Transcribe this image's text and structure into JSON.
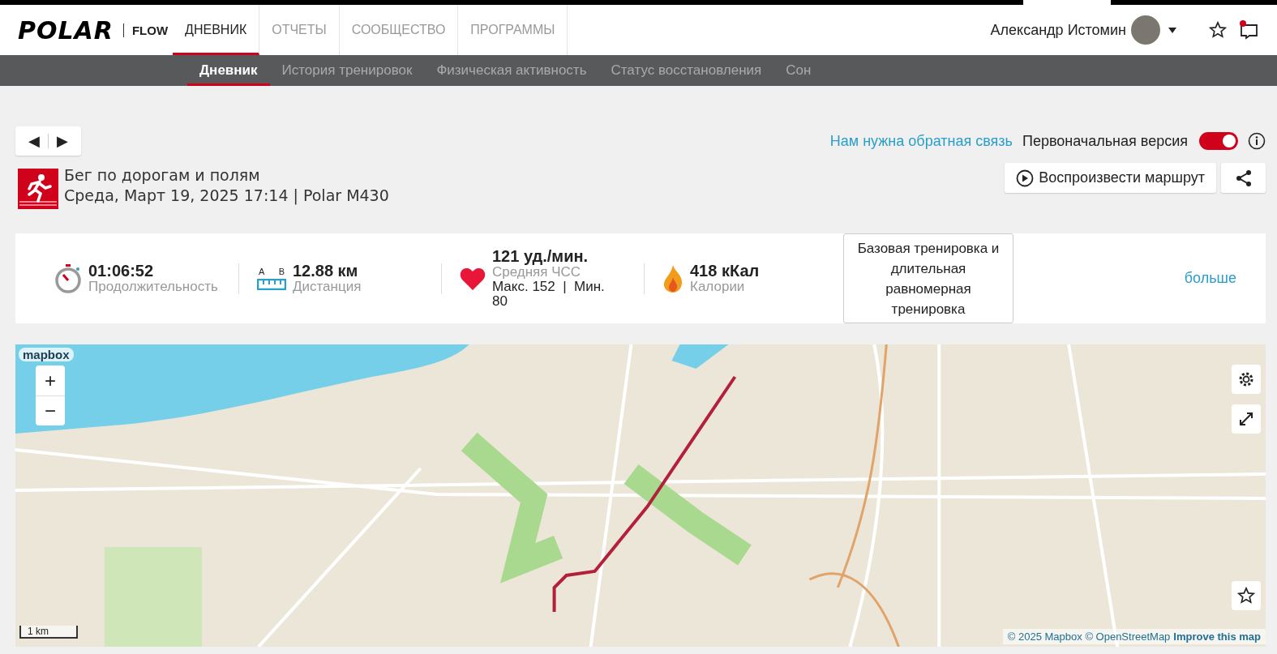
{
  "header": {
    "logo": "POLAR",
    "product": "FLOW",
    "nav": [
      {
        "label": "ДНЕВНИК",
        "selected": true
      },
      {
        "label": "ОТЧЕТЫ",
        "selected": false
      },
      {
        "label": "СООБЩЕСТВО",
        "selected": false
      },
      {
        "label": "ПРОГРАММЫ",
        "selected": false
      }
    ],
    "user_name": "Александр Истомин",
    "notifications": true
  },
  "subnav": [
    {
      "label": "Дневник",
      "selected": true
    },
    {
      "label": "История тренировок",
      "selected": false
    },
    {
      "label": "Физическая активность",
      "selected": false
    },
    {
      "label": "Статус восстановления",
      "selected": false
    },
    {
      "label": "Сон",
      "selected": false
    }
  ],
  "toolbar": {
    "prev": "◀",
    "next": "▶",
    "feedback_link": "Нам нужна обратная связь",
    "original_version_label": "Первоначальная версия",
    "original_version_on": true
  },
  "session": {
    "title": "Бег по дорогам и полям",
    "subtitle": "Среда, Март 19, 2025 17:14 | Polar M430",
    "replay_button": "Воспроизвести маршрут"
  },
  "stats": [
    {
      "kind": "duration",
      "value": "01:06:52",
      "label": "Продолжительность"
    },
    {
      "kind": "distance",
      "value": "12.88 км",
      "label": "Дистанция",
      "a": "A",
      "b": "B"
    },
    {
      "kind": "heart",
      "value": "121 уд./мин.",
      "label": "Средняя ЧСС",
      "extra": "Макс. 152  |  Мин. 80"
    },
    {
      "kind": "calories",
      "value": "418 кКал",
      "label": "Калории"
    }
  ],
  "benefit": "Базовая тренировка и длительная равномерная тренировка",
  "more_link": "больше",
  "map": {
    "logo": "mapbox",
    "zoom_in": "+",
    "zoom_out": "−",
    "scale": "1 km",
    "attribution": "© 2025 Mapbox © OpenStreetMap",
    "improve_link": "Improve this map"
  }
}
